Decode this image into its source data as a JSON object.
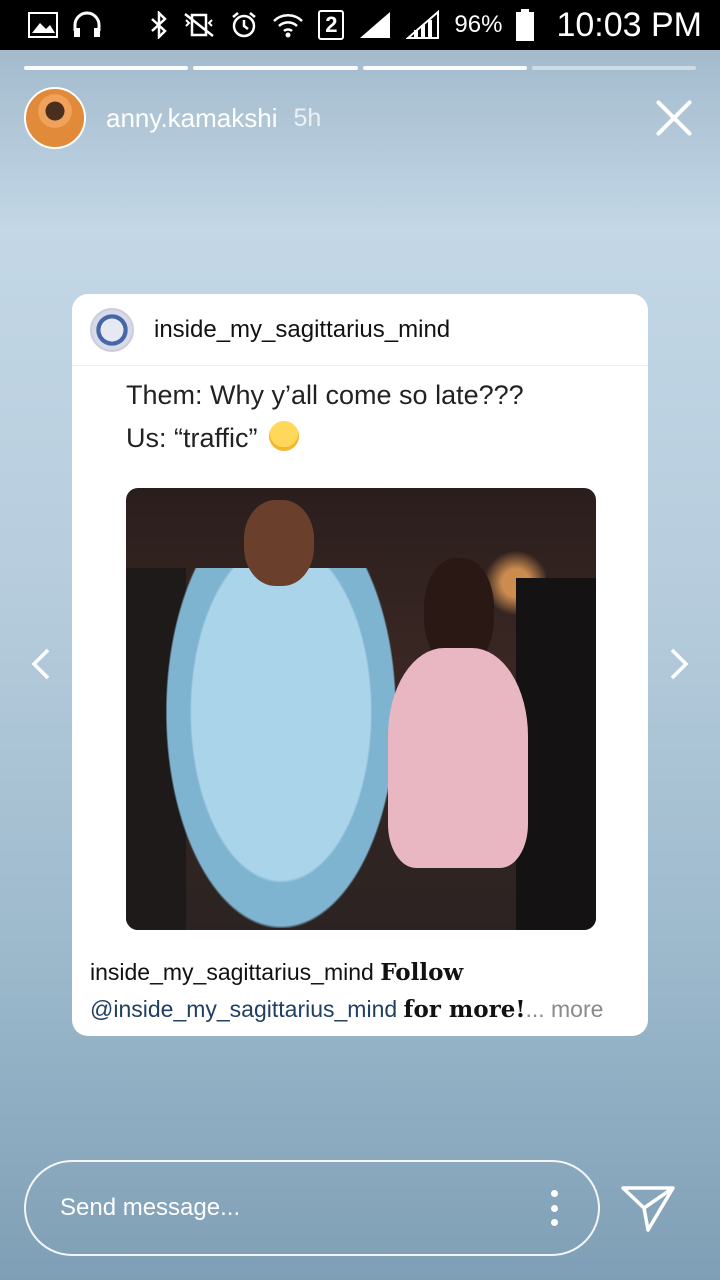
{
  "status_bar": {
    "battery": "96%",
    "time": "10:03 PM",
    "sim_badge": "2",
    "icons": [
      "gallery-icon",
      "headphones-icon",
      "bluetooth-icon",
      "vibrate-icon",
      "alarm-icon",
      "wifi-icon",
      "signal-icon",
      "signal-icon",
      "battery-icon"
    ]
  },
  "story": {
    "segments_total": 4,
    "segments_done": 3,
    "username": "anny.kamakshi",
    "time_ago": "5h"
  },
  "post": {
    "username": "inside_my_sagittarius_mind",
    "text_line1": "Them: Why y’all come so late???",
    "text_line2": "Us: “traffic”",
    "caption_user": "inside_my_sagittarius_mind",
    "caption_follow": "Follow",
    "caption_mention": "@inside_my_sagittarius_mind",
    "caption_for_more": "for more!",
    "caption_ellipsis_more": "... more"
  },
  "reply": {
    "placeholder": "Send message..."
  },
  "colors": {
    "status_bar_bg": "#000000",
    "mention": "#1f3f63"
  }
}
